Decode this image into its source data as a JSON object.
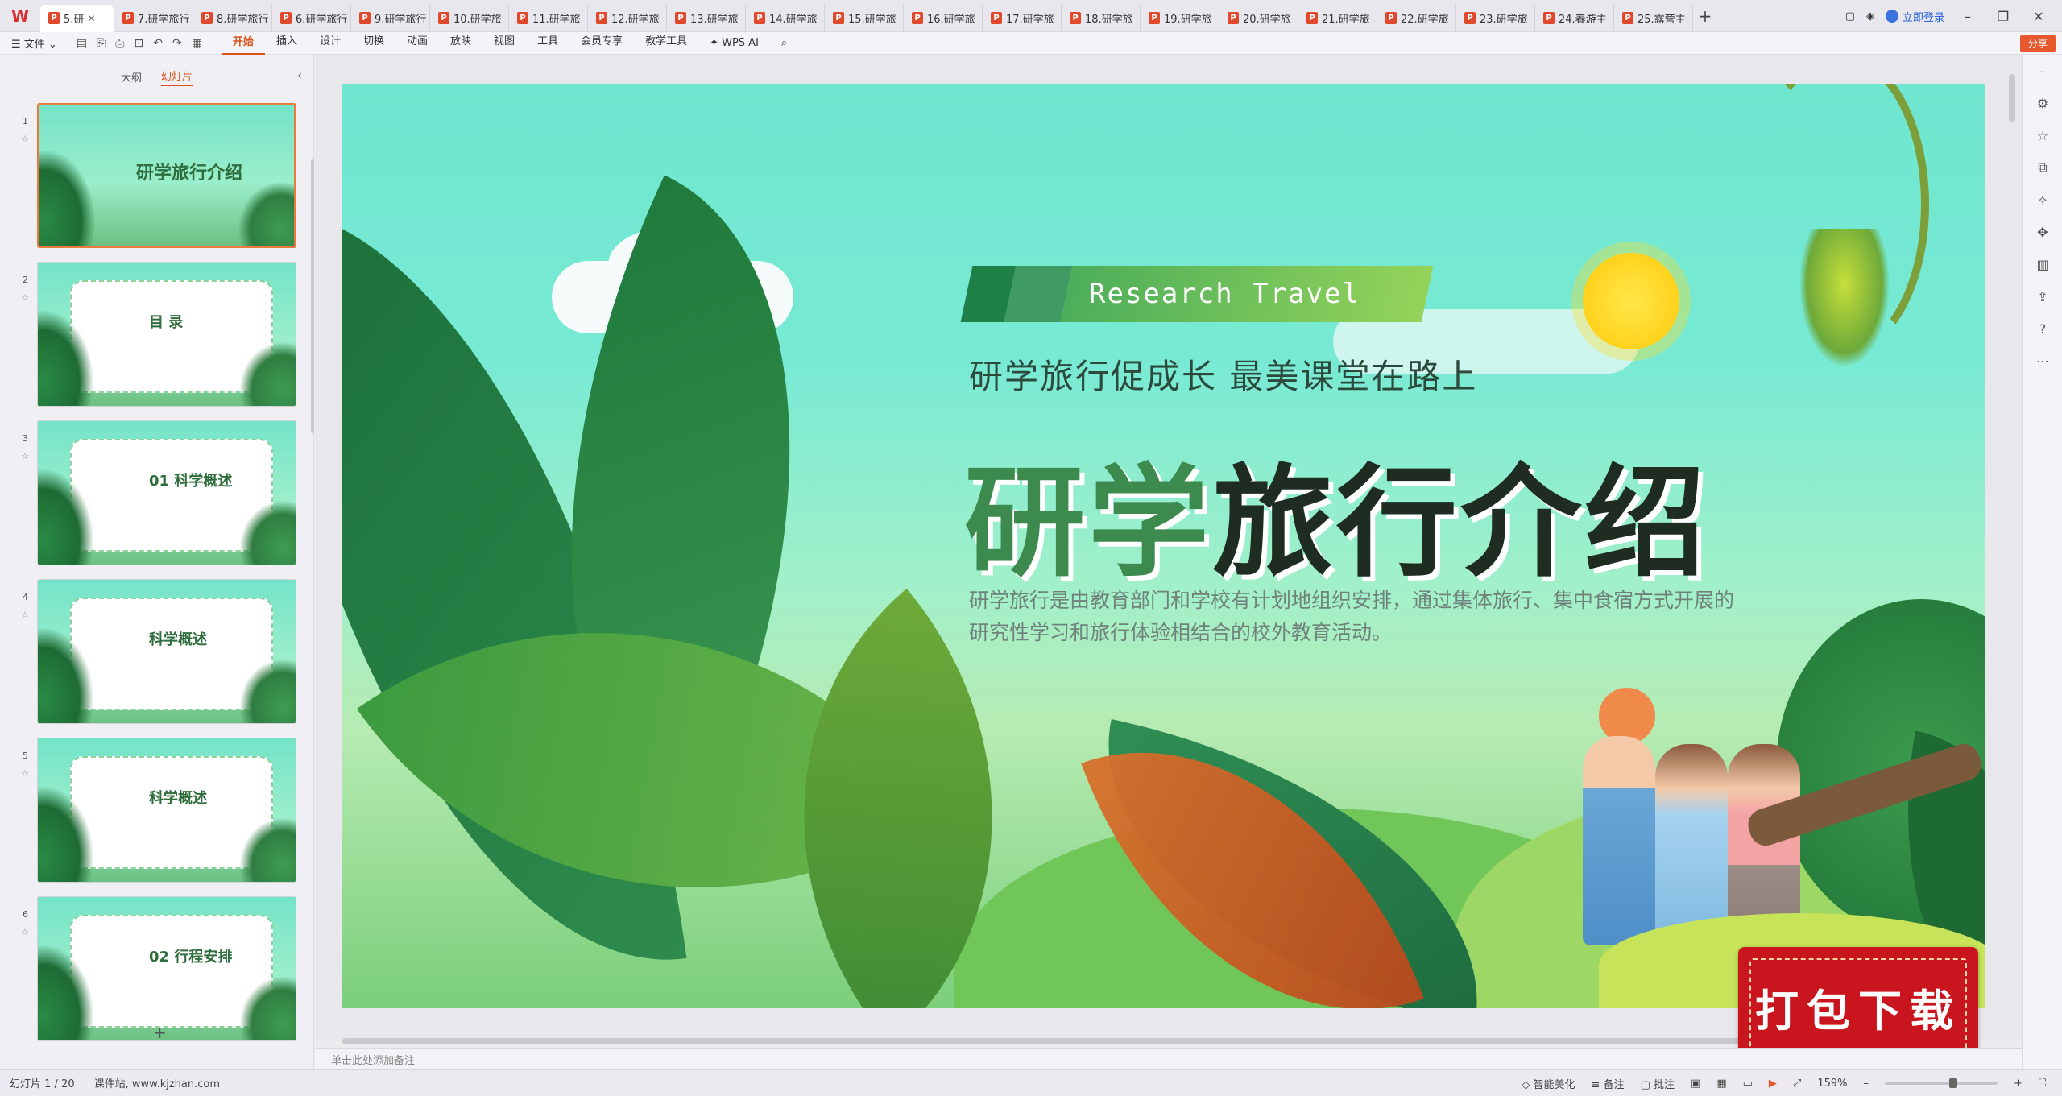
{
  "tabs": [
    {
      "label": "5.研"
    },
    {
      "label": "7.研学旅行"
    },
    {
      "label": "8.研学旅行"
    },
    {
      "label": "6.研学旅行"
    },
    {
      "label": "9.研学旅行"
    },
    {
      "label": "10.研学旅"
    },
    {
      "label": "11.研学旅"
    },
    {
      "label": "12.研学旅"
    },
    {
      "label": "13.研学旅"
    },
    {
      "label": "14.研学旅"
    },
    {
      "label": "15.研学旅"
    },
    {
      "label": "16.研学旅"
    },
    {
      "label": "17.研学旅"
    },
    {
      "label": "18.研学旅"
    },
    {
      "label": "19.研学旅"
    },
    {
      "label": "20.研学旅"
    },
    {
      "label": "21.研学旅"
    },
    {
      "label": "22.研学旅"
    },
    {
      "label": "23.研学旅"
    },
    {
      "label": "24.春游主"
    },
    {
      "label": "25.露营主"
    }
  ],
  "title_right": {
    "login": "立即登录"
  },
  "menu": {
    "file": "文件",
    "items": [
      "开始",
      "插入",
      "设计",
      "切换",
      "动画",
      "放映",
      "视图",
      "工具",
      "会员专享",
      "教学工具"
    ],
    "wps_ai": "WPS AI",
    "share": "分享"
  },
  "sidebar": {
    "tab_outline": "大纲",
    "tab_slides": "幻灯片",
    "thumbs": [
      {
        "num": "1",
        "title": "研学旅行介绍"
      },
      {
        "num": "2",
        "title": "目 录"
      },
      {
        "num": "3",
        "title": "01 科学概述"
      },
      {
        "num": "4",
        "title": "科学概述"
      },
      {
        "num": "5",
        "title": "科学概述"
      },
      {
        "num": "6",
        "title": "02 行程安排"
      }
    ],
    "add": "+"
  },
  "slide": {
    "badge_en": "Research Travel",
    "subtitle": "研学旅行促成长  最美课堂在路上",
    "title_green": "研学",
    "title_dark": "旅行介绍",
    "desc": "研学旅行是由教育部门和学校有计划地组织安排，通过集体旅行、集中食宿方式开展的研究性学习和旅行体验相结合的校外教育活动。"
  },
  "download_badge": "打包下载",
  "notes_placeholder": "单击此处添加备注",
  "status": {
    "slide_count": "幻灯片 1 / 20",
    "source": "课件站, www.kjzhan.com",
    "smart": "智能美化",
    "notes": "备注",
    "comment": "批注",
    "zoom": "159%"
  }
}
